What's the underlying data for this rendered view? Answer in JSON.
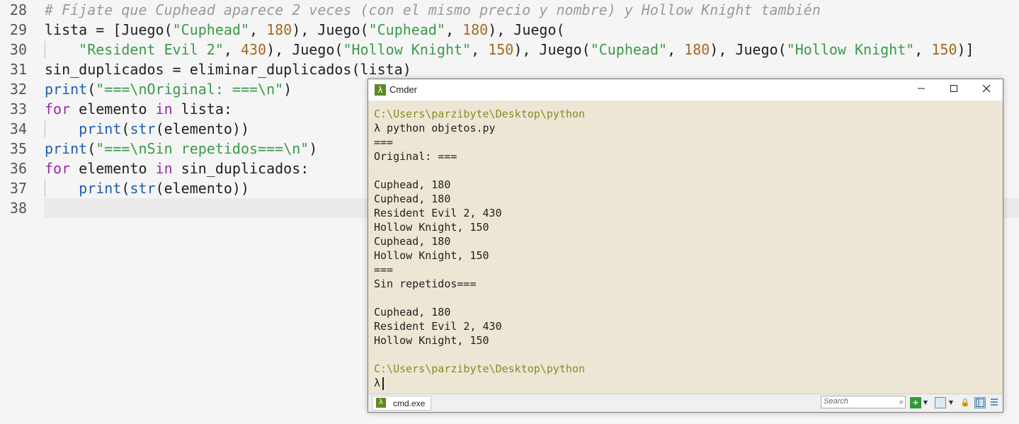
{
  "editor": {
    "lines": [
      {
        "n": "28",
        "segs": [
          {
            "t": "# Fíjate que Cuphead aparece 2 veces (con el mismo precio y nombre) y Hollow Knight también",
            "c": "c-comment"
          }
        ]
      },
      {
        "n": "29",
        "segs": [
          {
            "t": "lista = [Juego(",
            "c": ""
          },
          {
            "t": "\"Cuphead\"",
            "c": "c-str"
          },
          {
            "t": ", ",
            "c": ""
          },
          {
            "t": "180",
            "c": "c-num"
          },
          {
            "t": "), Juego(",
            "c": ""
          },
          {
            "t": "\"Cuphead\"",
            "c": "c-str"
          },
          {
            "t": ", ",
            "c": ""
          },
          {
            "t": "180",
            "c": "c-num"
          },
          {
            "t": "), Juego(",
            "c": ""
          }
        ]
      },
      {
        "n": "30",
        "segs": [
          {
            "t": "    ",
            "c": ""
          },
          {
            "t": "\"Resident Evil 2\"",
            "c": "c-str"
          },
          {
            "t": ", ",
            "c": ""
          },
          {
            "t": "430",
            "c": "c-num"
          },
          {
            "t": "), Juego(",
            "c": ""
          },
          {
            "t": "\"Hollow Knight\"",
            "c": "c-str"
          },
          {
            "t": ", ",
            "c": ""
          },
          {
            "t": "150",
            "c": "c-num"
          },
          {
            "t": "), Juego(",
            "c": ""
          },
          {
            "t": "\"Cuphead\"",
            "c": "c-str"
          },
          {
            "t": ", ",
            "c": ""
          },
          {
            "t": "180",
            "c": "c-num"
          },
          {
            "t": "), Juego(",
            "c": ""
          },
          {
            "t": "\"Hollow Knight\"",
            "c": "c-str"
          },
          {
            "t": ", ",
            "c": ""
          },
          {
            "t": "150",
            "c": "c-num"
          },
          {
            "t": ")]",
            "c": ""
          }
        ]
      },
      {
        "n": "31",
        "segs": [
          {
            "t": "sin_duplicados = eliminar_duplicados(lista)",
            "c": ""
          }
        ]
      },
      {
        "n": "32",
        "segs": [
          {
            "t": "print",
            "c": "c-fn"
          },
          {
            "t": "(",
            "c": ""
          },
          {
            "t": "\"===\\nOriginal: ===\\n\"",
            "c": "c-str"
          },
          {
            "t": ")",
            "c": ""
          }
        ]
      },
      {
        "n": "33",
        "segs": [
          {
            "t": "for",
            "c": "c-kw"
          },
          {
            "t": " elemento ",
            "c": ""
          },
          {
            "t": "in",
            "c": "c-kw"
          },
          {
            "t": " lista:",
            "c": ""
          }
        ]
      },
      {
        "n": "34",
        "segs": [
          {
            "t": "    ",
            "c": ""
          },
          {
            "t": "print",
            "c": "c-fn"
          },
          {
            "t": "(",
            "c": ""
          },
          {
            "t": "str",
            "c": "c-fn"
          },
          {
            "t": "(elemento))",
            "c": ""
          }
        ]
      },
      {
        "n": "35",
        "segs": [
          {
            "t": "print",
            "c": "c-fn"
          },
          {
            "t": "(",
            "c": ""
          },
          {
            "t": "\"===\\nSin repetidos===\\n\"",
            "c": "c-str"
          },
          {
            "t": ")",
            "c": ""
          }
        ]
      },
      {
        "n": "36",
        "segs": [
          {
            "t": "for",
            "c": "c-kw"
          },
          {
            "t": " elemento ",
            "c": ""
          },
          {
            "t": "in",
            "c": "c-kw"
          },
          {
            "t": " sin_duplicados:",
            "c": ""
          }
        ]
      },
      {
        "n": "37",
        "segs": [
          {
            "t": "    ",
            "c": ""
          },
          {
            "t": "print",
            "c": "c-fn"
          },
          {
            "t": "(",
            "c": ""
          },
          {
            "t": "str",
            "c": "c-fn"
          },
          {
            "t": "(elemento))",
            "c": ""
          }
        ]
      },
      {
        "n": "38",
        "segs": []
      }
    ]
  },
  "window": {
    "title": "Cmder",
    "app_icon": "lambda-icon",
    "minimize_label": "—",
    "maximize_label": "☐",
    "close_label": "✕"
  },
  "console": {
    "lines": [
      {
        "t": "C:\\Users\\parzibyte\\Desktop\\python",
        "c": "path"
      },
      {
        "t": "λ python objetos.py",
        "c": ""
      },
      {
        "t": "===",
        "c": ""
      },
      {
        "t": "Original: ===",
        "c": ""
      },
      {
        "t": "",
        "c": ""
      },
      {
        "t": "Cuphead, 180",
        "c": ""
      },
      {
        "t": "Cuphead, 180",
        "c": ""
      },
      {
        "t": "Resident Evil 2, 430",
        "c": ""
      },
      {
        "t": "Hollow Knight, 150",
        "c": ""
      },
      {
        "t": "Cuphead, 180",
        "c": ""
      },
      {
        "t": "Hollow Knight, 150",
        "c": ""
      },
      {
        "t": "===",
        "c": ""
      },
      {
        "t": "Sin repetidos===",
        "c": ""
      },
      {
        "t": "",
        "c": ""
      },
      {
        "t": "Cuphead, 180",
        "c": ""
      },
      {
        "t": "Resident Evil 2, 430",
        "c": ""
      },
      {
        "t": "Hollow Knight, 150",
        "c": ""
      },
      {
        "t": "",
        "c": ""
      },
      {
        "t": "C:\\Users\\parzibyte\\Desktop\\python",
        "c": "path"
      }
    ],
    "prompt": "λ"
  },
  "statusbar": {
    "tab_label": "cmd.exe",
    "search_placeholder": "Search",
    "icons": [
      "add-console-icon",
      "dropdown-icon",
      "view-icon",
      "dropdown-icon",
      "lock-icon",
      "split-icon",
      "menu-icon"
    ]
  },
  "colors": {
    "console_bg": "#ede6d4",
    "path_color": "#8a8a2a",
    "string_color": "#3a9a4a",
    "number_color": "#a56a1b",
    "keyword_color": "#9b2aa8",
    "function_color": "#1f5fb0"
  }
}
